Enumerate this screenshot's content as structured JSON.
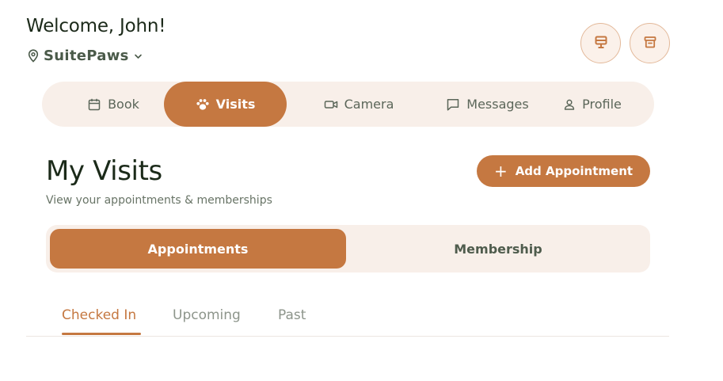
{
  "header": {
    "welcome": "Welcome, John!",
    "location": "SuitePaws",
    "location_icon": "map-pin-icon",
    "location_caret": "chevron-down-icon",
    "action_icons": [
      "kiosk-icon",
      "archive-icon"
    ]
  },
  "nav": {
    "items": [
      {
        "label": "Book",
        "icon": "calendar-icon"
      },
      {
        "label": "Visits",
        "icon": "paw-icon",
        "active": true
      },
      {
        "label": "Camera",
        "icon": "video-icon"
      },
      {
        "label": "Messages",
        "icon": "message-icon"
      },
      {
        "label": "Profile",
        "icon": "user-icon"
      }
    ]
  },
  "page": {
    "title": "My Visits",
    "subtitle": "View your appointments & memberships",
    "add_button": "Add Appointment"
  },
  "segments": {
    "items": [
      "Appointments",
      "Membership"
    ],
    "active": "Appointments"
  },
  "tabs": {
    "items": [
      "Checked In",
      "Upcoming",
      "Past"
    ],
    "active": "Checked In"
  },
  "colors": {
    "accent": "#c57841",
    "soft_bg": "#f8efe9",
    "text_dark": "#1c2a1a",
    "text_muted": "#8d958b"
  }
}
